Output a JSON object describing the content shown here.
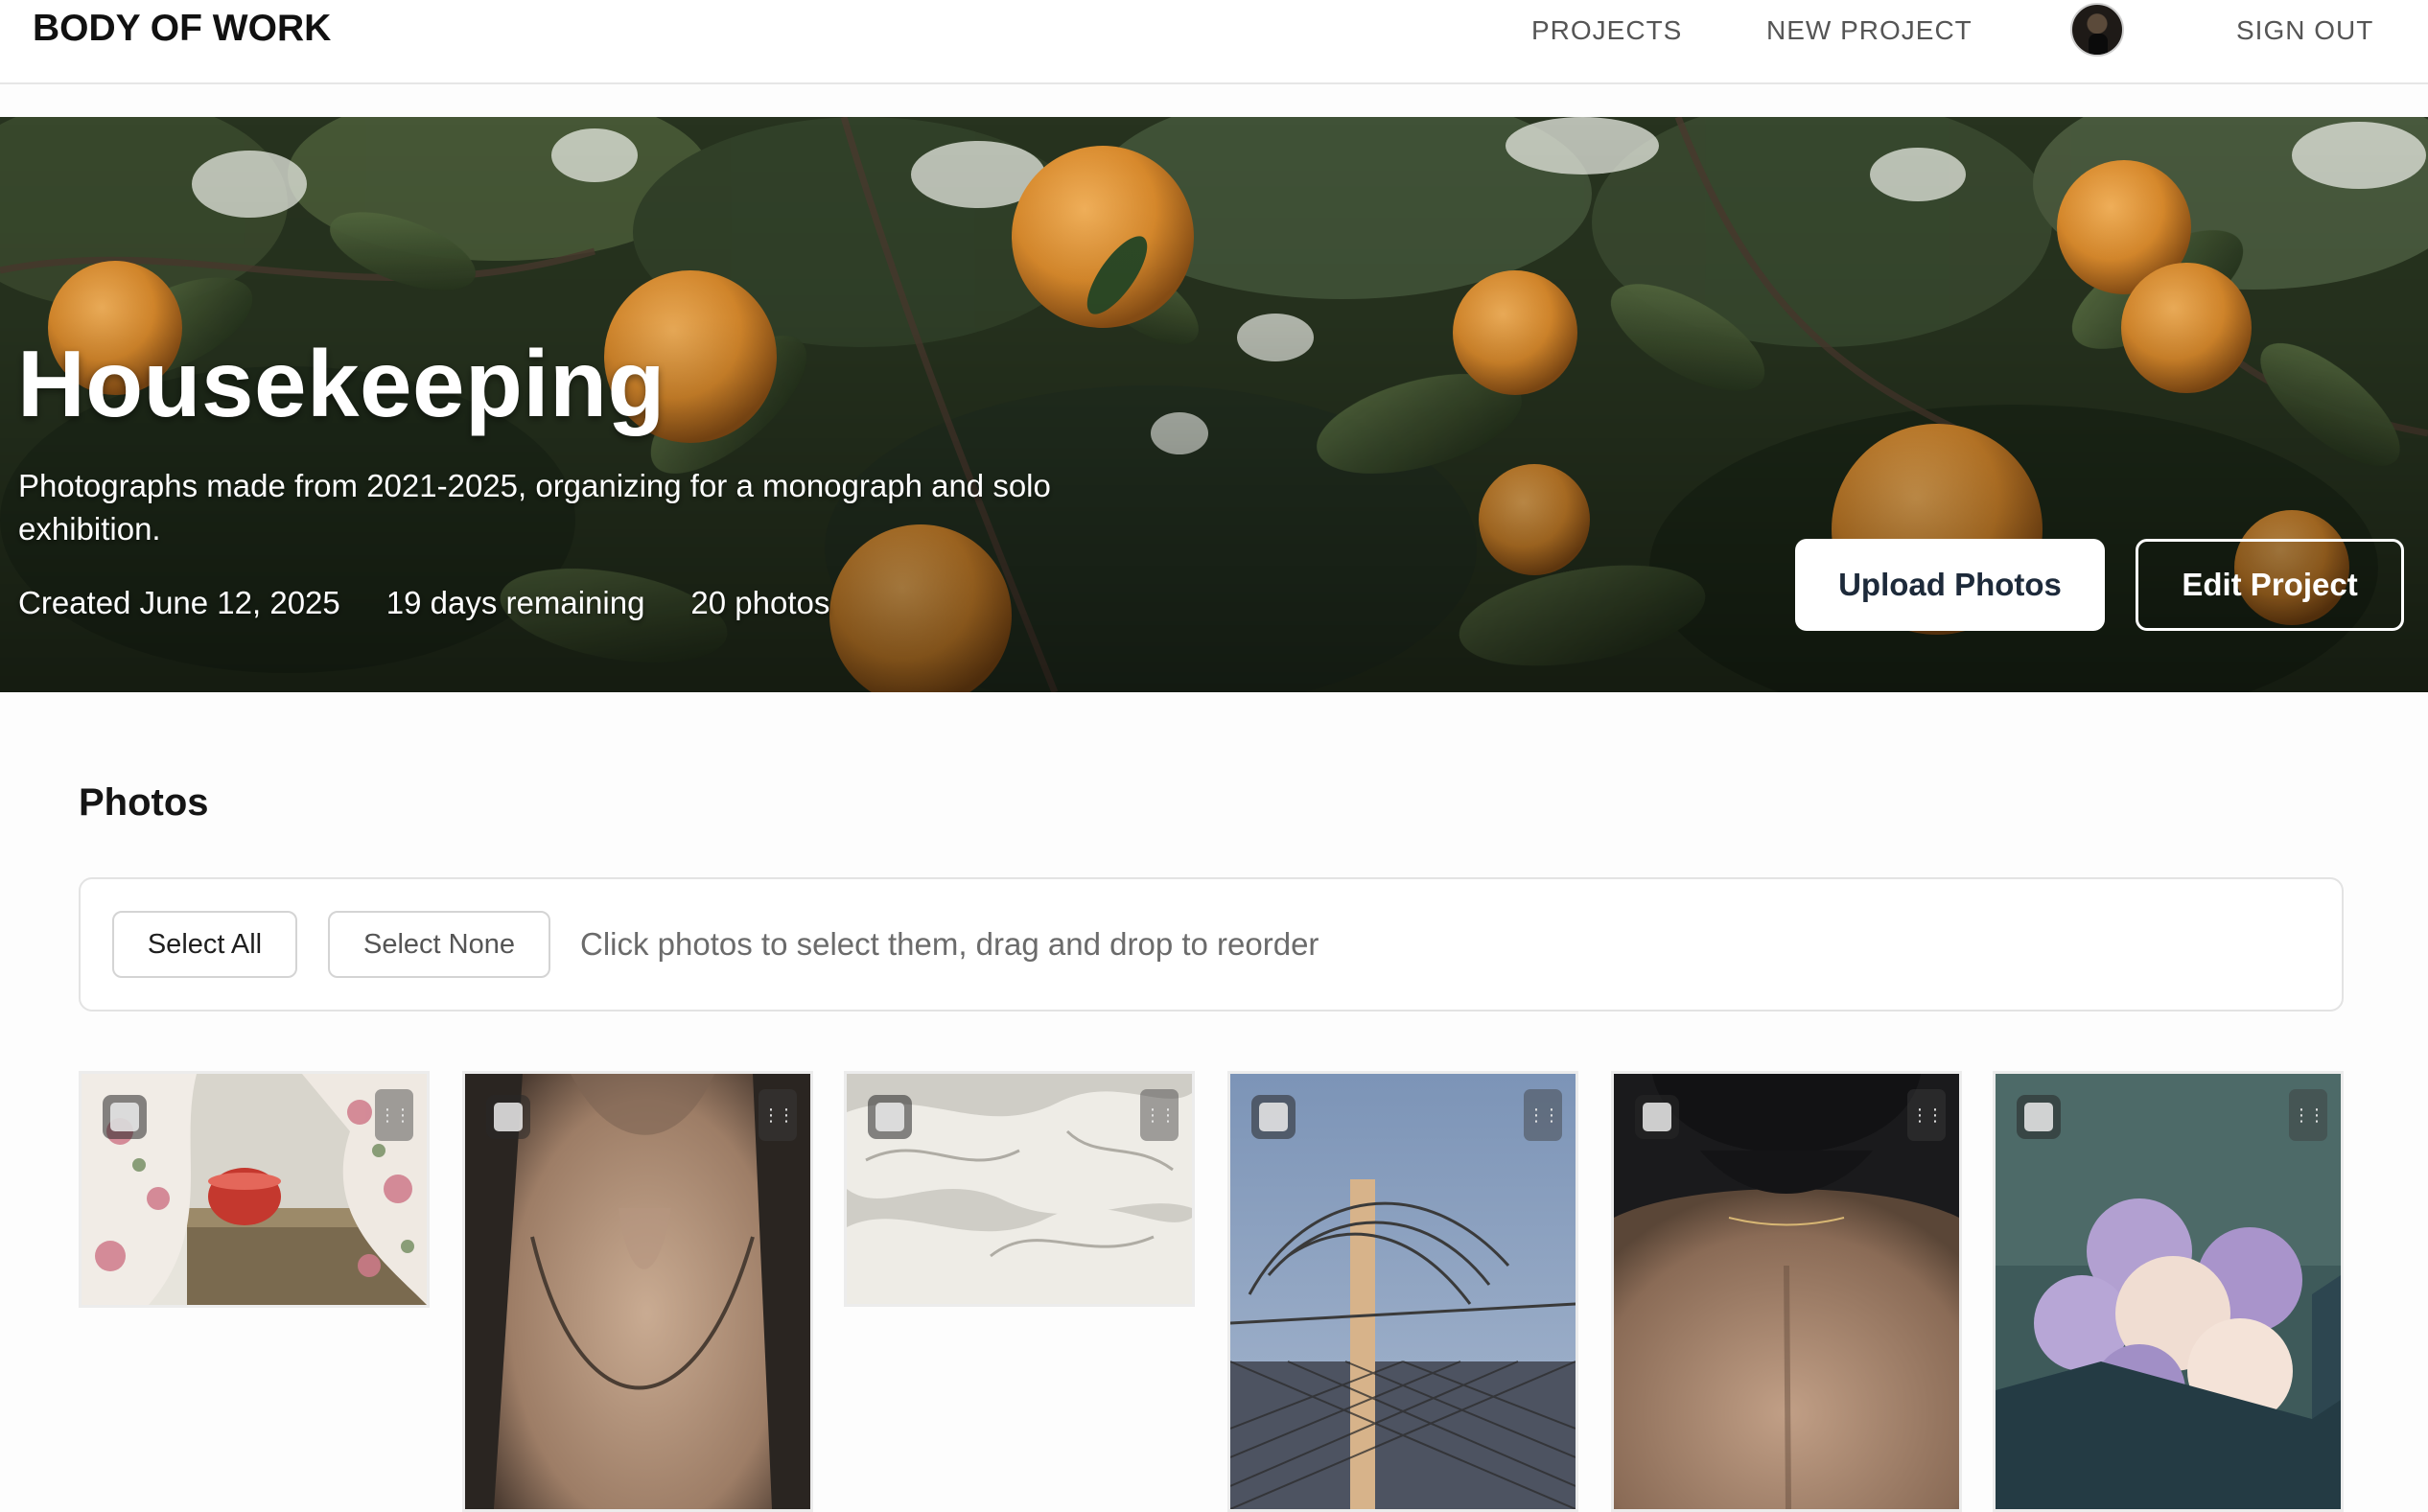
{
  "nav": {
    "brand": "BODY OF WORK",
    "links": [
      {
        "label": "PROJECTS"
      },
      {
        "label": "NEW PROJECT"
      }
    ],
    "sign_out": "SIGN OUT"
  },
  "project": {
    "title": "Housekeeping",
    "description": "Photographs made from 2021-2025, organizing for a monograph and solo exhibition.",
    "created": "Created June 12, 2025",
    "remaining": "19 days remaining",
    "count": "20 photos",
    "upload_label": "Upload Photos",
    "edit_label": "Edit Project"
  },
  "photos": {
    "section_title": "Photos",
    "select_all": "Select All",
    "select_none": "Select None",
    "hint": "Click photos to select them, drag and drop to reorder"
  },
  "icons": {
    "checkbox": "checkbox-icon",
    "drag_handle": "drag-handle-icon",
    "avatar": "user-avatar"
  },
  "colors": {
    "primary_text": "#111111",
    "muted_text": "#6b6b6b",
    "border": "#e3e3e3"
  }
}
